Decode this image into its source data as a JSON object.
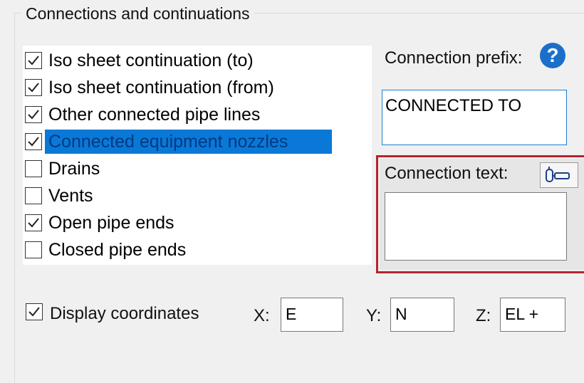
{
  "group": {
    "title": "Connections and continuations"
  },
  "options": [
    {
      "label": "Iso sheet continuation (to)",
      "checked": true,
      "selected": false
    },
    {
      "label": "Iso sheet continuation (from)",
      "checked": true,
      "selected": false
    },
    {
      "label": "Other connected pipe lines",
      "checked": true,
      "selected": false
    },
    {
      "label": "Connected equipment nozzles",
      "checked": true,
      "selected": true
    },
    {
      "label": "Drains",
      "checked": false,
      "selected": false
    },
    {
      "label": "Vents",
      "checked": false,
      "selected": false
    },
    {
      "label": "Open pipe ends",
      "checked": true,
      "selected": false
    },
    {
      "label": "Closed pipe ends",
      "checked": false,
      "selected": false
    }
  ],
  "prefix": {
    "label": "Connection prefix:",
    "value": "CONNECTED TO",
    "help_icon": "question-circle-icon"
  },
  "text": {
    "label": "Connection text:",
    "value": "",
    "button_icon": "link-icon"
  },
  "coordinates": {
    "display_label": "Display coordinates",
    "checked": true,
    "x_label": "X:",
    "x_value": "E",
    "y_label": "Y:",
    "y_value": "N",
    "z_label": "Z:",
    "z_value": "EL +"
  },
  "colors": {
    "selection": "#0a78d7",
    "highlight_frame": "#b3262e",
    "help": "#1b6fc9",
    "focus_border": "#1a7fd4"
  }
}
